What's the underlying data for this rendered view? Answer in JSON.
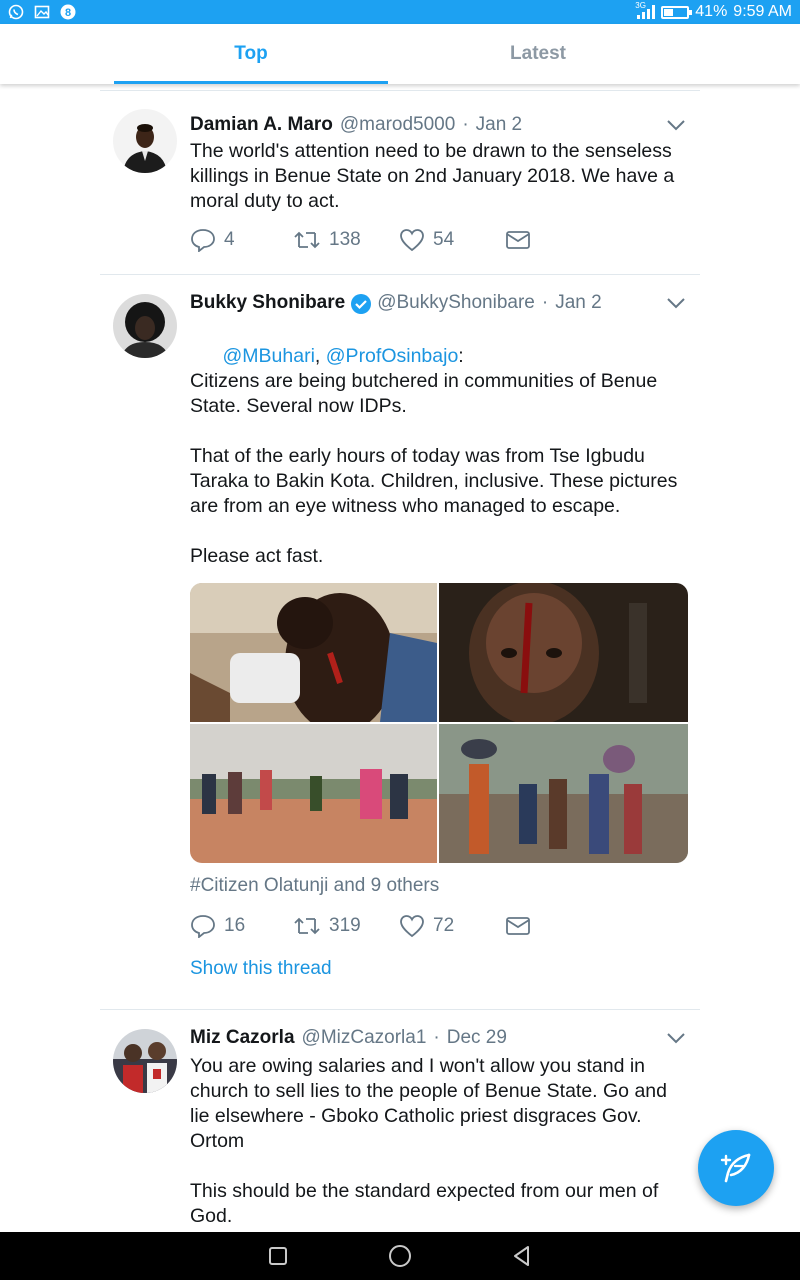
{
  "status_bar": {
    "battery": "41%",
    "battery_level": 0.41,
    "time": "9:59 AM",
    "network": "3G",
    "icons": [
      "whatsapp-icon",
      "gallery-icon",
      "app-icon"
    ]
  },
  "tabs": [
    {
      "label": "Top",
      "active": true
    },
    {
      "label": "Latest",
      "active": false
    }
  ],
  "tweets": [
    {
      "name": "Damian A. Maro",
      "handle": "@marod5000",
      "date": "Jan 2",
      "text": "The world's attention need to be drawn to the senseless killings in Benue State on 2nd January 2018. We have a moral duty to act.",
      "replies": "4",
      "retweets": "138",
      "likes": "54"
    },
    {
      "name": "Bukky Shonibare",
      "verified": true,
      "handle": "@BukkyShonibare",
      "date": "Jan 2",
      "mention1": "@MBuhari",
      "mention_sep": ", ",
      "mention2": "@ProfOsinbajo",
      "mention_end": ":",
      "text": "Citizens are being butchered in communities of Benue State. Several now IDPs.\n\nThat of the early hours of today was from Tse Igbudu Taraka to Bakin Kota. Children, inclusive. These pictures are from an eye witness who managed to escape.\n\nPlease act fast.",
      "tagged": "#Citizen Olatunji and 9 others",
      "replies": "16",
      "retweets": "319",
      "likes": "72",
      "thread": "Show this thread"
    },
    {
      "name": "Miz Cazorla",
      "handle": "@MizCazorla1",
      "date": "Dec 29",
      "text": "You are owing salaries and I won't allow you stand in church to sell lies to the people of Benue State. Go and lie elsewhere - Gboko Catholic priest disgraces Gov. Ortom\n\nThis should be the standard expected from our men of God."
    }
  ],
  "colors": {
    "accent": "#1da1f2",
    "link": "#1b95e0",
    "secondary_text": "#657786",
    "divider": "#e1e8ed"
  }
}
